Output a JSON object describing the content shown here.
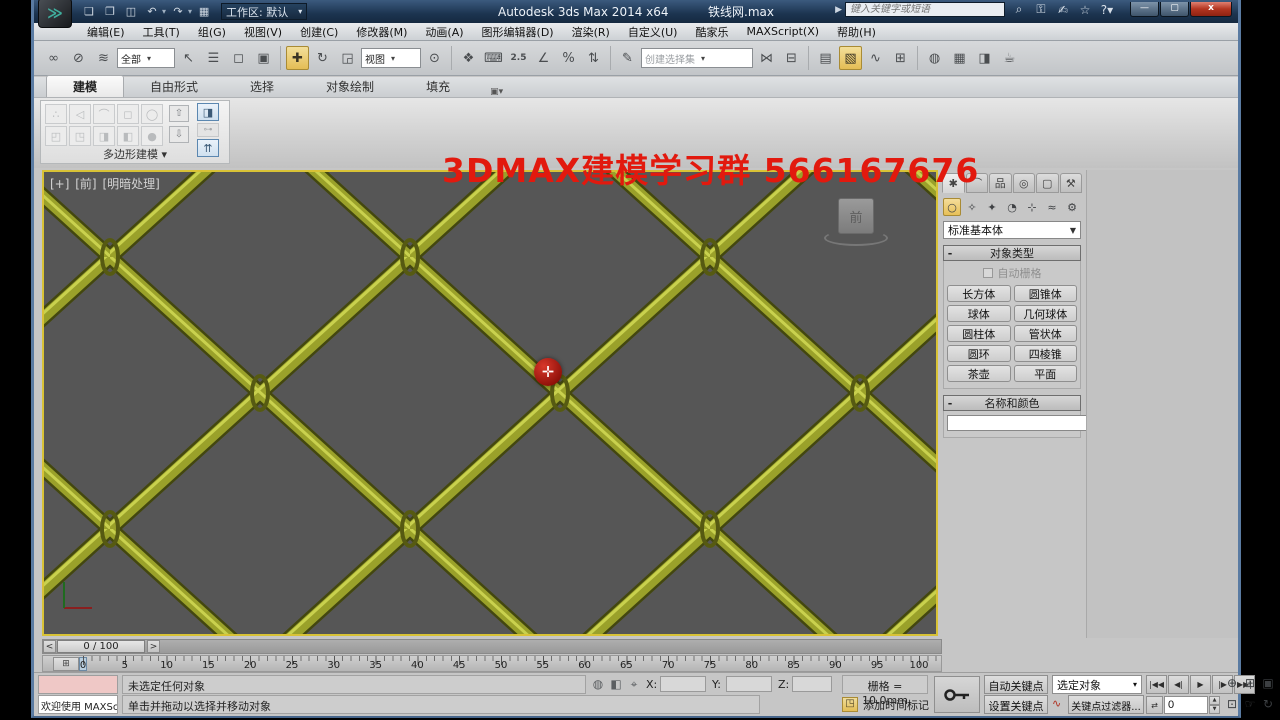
{
  "window": {
    "app_title": "Autodesk 3ds Max  2014 x64",
    "file_title": "铁线网.max",
    "workspace_label": "工作区: 默认",
    "search_placeholder": "键入关键字或短语",
    "help_label": "?",
    "minimize_label": "—",
    "maximize_label": "▢",
    "close_label": "x"
  },
  "menu": {
    "items": [
      "编辑(E)",
      "工具(T)",
      "组(G)",
      "视图(V)",
      "创建(C)",
      "修改器(M)",
      "动画(A)",
      "图形编辑器(D)",
      "渲染(R)",
      "自定义(U)",
      "酷家乐",
      "MAXScript(X)",
      "帮助(H)"
    ]
  },
  "toolbar": {
    "filter_value": "全部",
    "coord_value": "视图",
    "selection_set_value": "创建选择集",
    "snap_value": "2.5"
  },
  "ribbon": {
    "tabs": [
      "建模",
      "自由形式",
      "选择",
      "对象绘制",
      "填充"
    ],
    "active_tab": "建模",
    "panel_label": "多边形建模 ▾"
  },
  "overlay": {
    "text": "3DMAX建模学习群  566167676",
    "color": "#e2190e"
  },
  "viewport": {
    "label_plus": "[+]",
    "label_view": "[前]",
    "label_shading": "[明暗处理]",
    "viewcube_face": "前",
    "bg_color": "#565656",
    "fence_color": "#9aa12a"
  },
  "command_panel": {
    "category_value": "标准基本体",
    "object_type_title": "对象类型",
    "autogrid_label": "自动栅格",
    "primitive_buttons": [
      "长方体",
      "圆锥体",
      "球体",
      "几何球体",
      "圆柱体",
      "管状体",
      "圆环",
      "四棱锥",
      "茶壶",
      "平面"
    ],
    "name_color_title": "名称和颜色",
    "name_value": "",
    "swatch_color": "#b81a3e"
  },
  "timeline": {
    "slider_label": "0 / 100",
    "prev_arrow": "<",
    "next_arrow": ">",
    "ticks": [
      0,
      5,
      10,
      15,
      20,
      25,
      30,
      35,
      40,
      45,
      50,
      55,
      60,
      65,
      70,
      75,
      80,
      85,
      90,
      95,
      100
    ]
  },
  "status": {
    "listener_welcome": "欢迎使用 MAXScr",
    "status_line": "未选定任何对象",
    "prompt_line": "单击并拖动以选择并移动对象",
    "x_label": "X:",
    "y_label": "Y:",
    "z_label": "Z:",
    "x_value": "",
    "y_value": "",
    "z_value": "",
    "grid_label": "栅格 = 10.0mm",
    "add_time_tag": "添加时间标记",
    "auto_key": "自动关键点",
    "set_key": "设置关键点",
    "selected_filter": "选定对象",
    "key_filters": "关键点过滤器...",
    "frame_value": "0"
  }
}
